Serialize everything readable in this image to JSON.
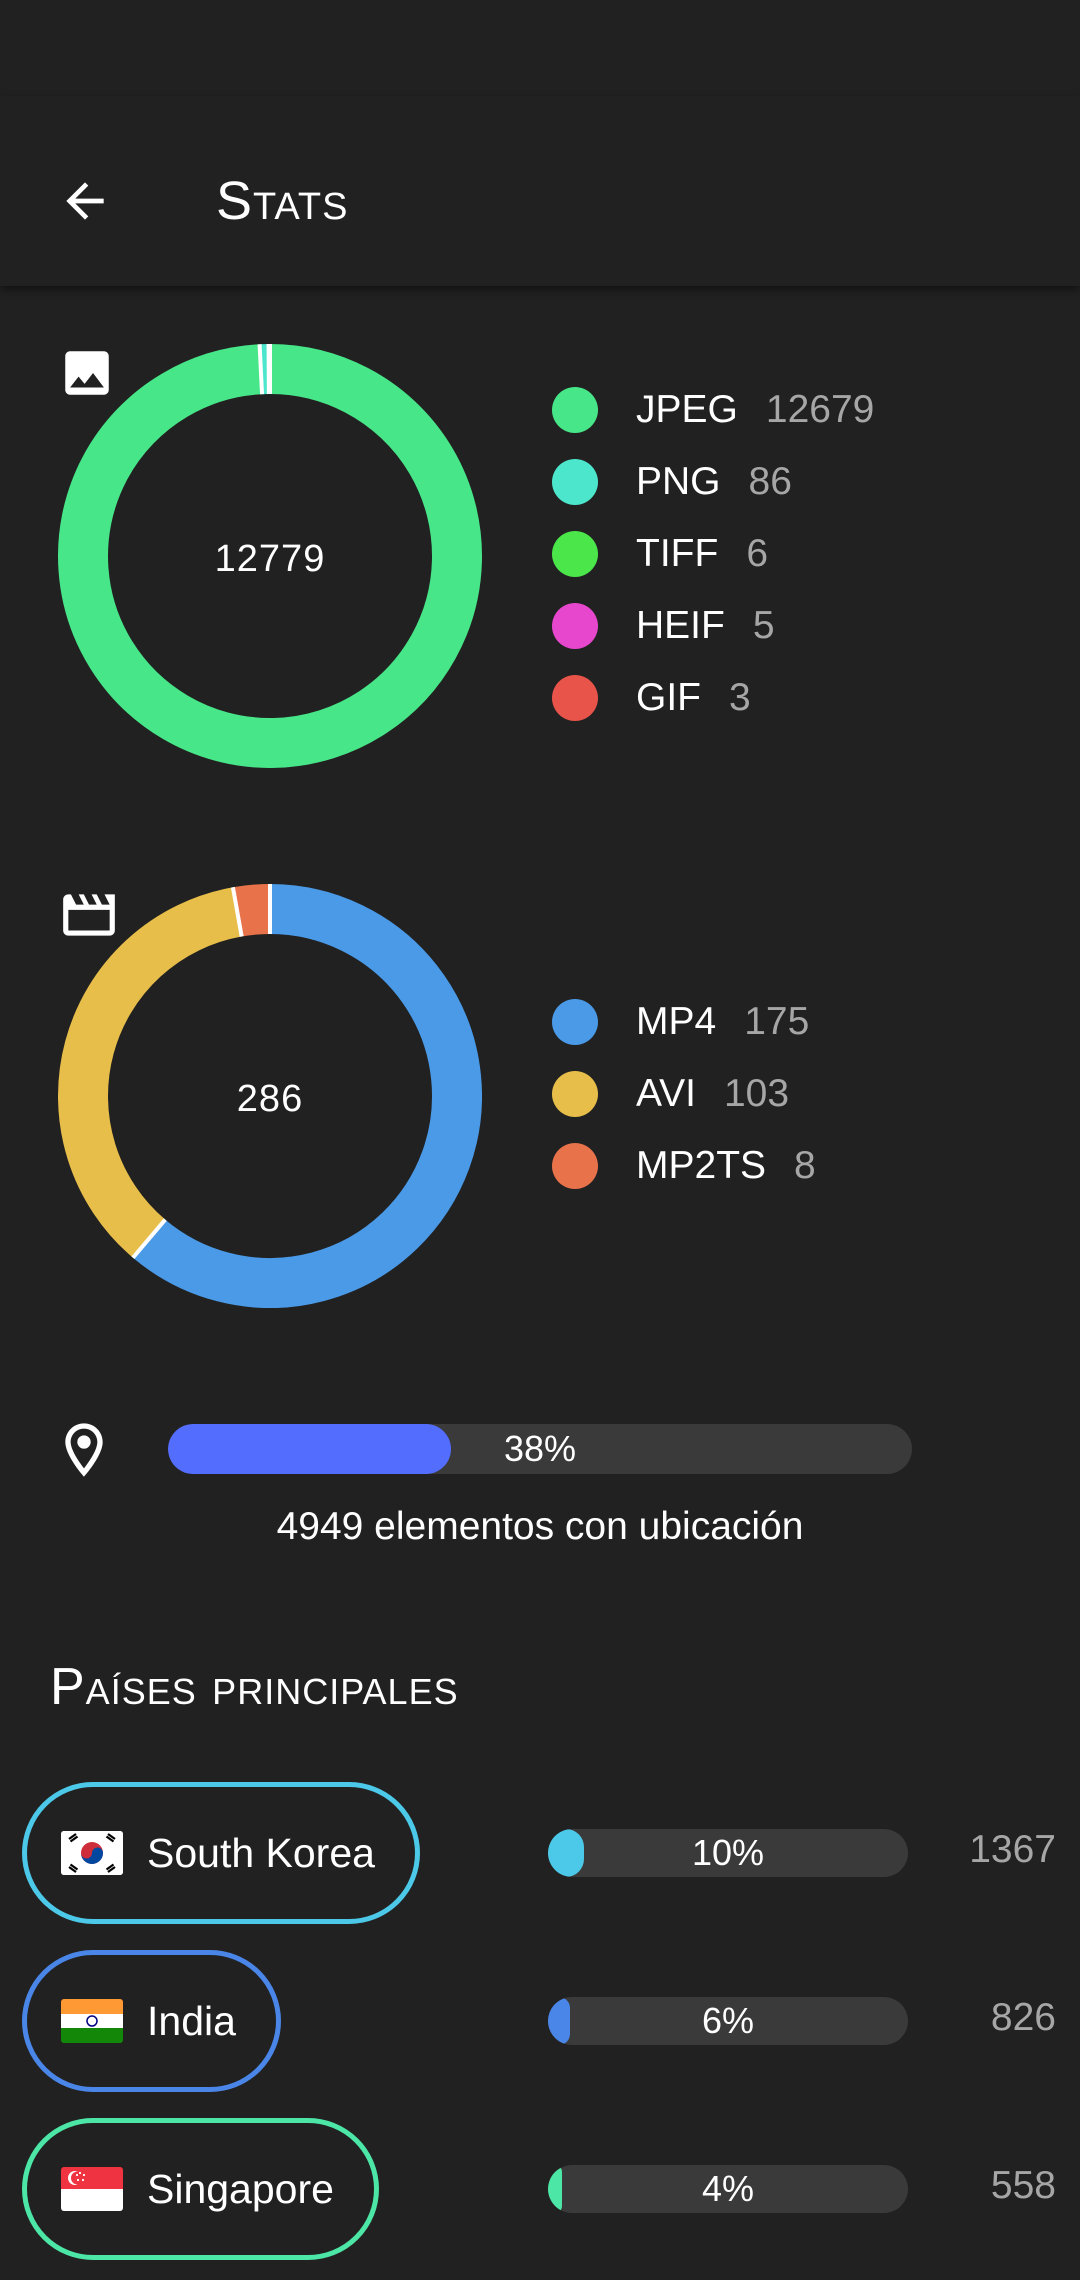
{
  "app_bar": {
    "title": "Stats",
    "back_icon": "arrow-back-icon"
  },
  "image_types": {
    "icon": "image-icon",
    "total": "12779",
    "items": [
      {
        "label": "JPEG",
        "count": "12679",
        "color": "#47e688"
      },
      {
        "label": "PNG",
        "count": "86",
        "color": "#4ce6cc"
      },
      {
        "label": "TIFF",
        "count": "6",
        "color": "#4ae64a"
      },
      {
        "label": "HEIF",
        "count": "5",
        "color": "#e647cc"
      },
      {
        "label": "GIF",
        "count": "3",
        "color": "#e8544a"
      }
    ]
  },
  "video_types": {
    "icon": "movie-clapper-icon",
    "total": "286",
    "items": [
      {
        "label": "MP4",
        "count": "175",
        "color": "#4a9ae8"
      },
      {
        "label": "AVI",
        "count": "103",
        "color": "#e8be4a"
      },
      {
        "label": "MP2TS",
        "count": "8",
        "color": "#e8724a"
      }
    ]
  },
  "location": {
    "icon": "location-pin-icon",
    "percent_text": "38%",
    "fraction": 0.38,
    "bar_color": "#536dfe",
    "caption": "4949 elementos con ubicación"
  },
  "countries": {
    "title": "Países principales",
    "items": [
      {
        "name": "South Korea",
        "flag": "south-korea-flag-icon",
        "percent_text": "10%",
        "fraction": 0.1,
        "count": "1367",
        "color": "#4cc9e8"
      },
      {
        "name": "India",
        "flag": "india-flag-icon",
        "percent_text": "6%",
        "fraction": 0.06,
        "count": "826",
        "color": "#4a86e8"
      },
      {
        "name": "Singapore",
        "flag": "singapore-flag-icon",
        "percent_text": "4%",
        "fraction": 0.04,
        "count": "558",
        "color": "#4ce6a6"
      }
    ]
  }
}
